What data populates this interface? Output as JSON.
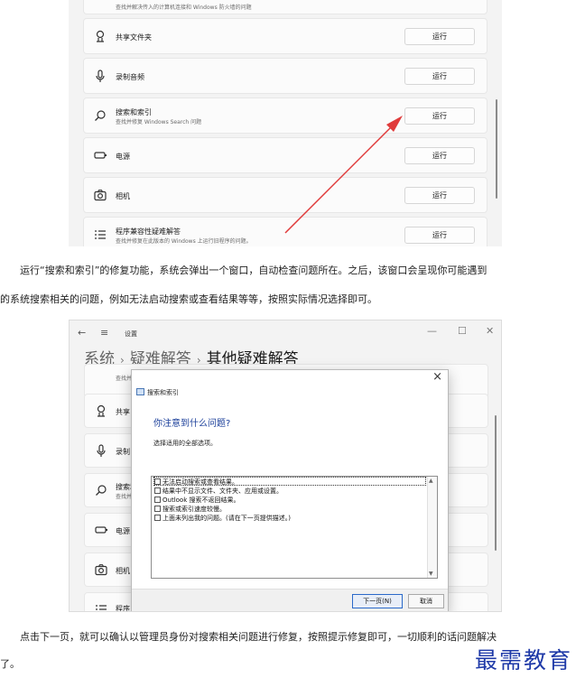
{
  "shot1": {
    "top_partial_subtitle": "查找并解决传入的计算机连接和 Windows 防火墙的问题",
    "rows": [
      {
        "icon": "share-icon",
        "title": "共享文件夹",
        "subtitle": "",
        "button": "运行"
      },
      {
        "icon": "microphone-icon",
        "title": "录制音频",
        "subtitle": "",
        "button": "运行"
      },
      {
        "icon": "search-icon",
        "title": "搜索和索引",
        "subtitle": "查找并修复 Windows Search 问题",
        "button": "运行"
      },
      {
        "icon": "battery-icon",
        "title": "电源",
        "subtitle": "",
        "button": "运行"
      },
      {
        "icon": "camera-icon",
        "title": "相机",
        "subtitle": "",
        "button": "运行"
      },
      {
        "icon": "list-icon",
        "title": "程序兼容性疑难解答",
        "subtitle": "查找并修复在此版本的 Windows 上运行旧程序的问题。",
        "button": "运行"
      }
    ]
  },
  "para1": {
    "line1": "运行“搜索和索引”的修复功能，系统会弹出一个窗口，自动检查问题所在。之后，该窗口会呈现你可能遇到",
    "line2": "的系统搜索相关的问题，例如无法启动搜索或查看结果等等，按照实际情况选择即可。"
  },
  "shot2": {
    "back": "←",
    "menu": "≡",
    "app_title": "设置",
    "minimize": "—",
    "maximize": "☐",
    "close": "✕",
    "breadcrumb": [
      "系统",
      "疑难解答",
      "其他疑难解答"
    ],
    "separator": "›",
    "rows": [
      {
        "title": "",
        "subtitle": "查找并"
      },
      {
        "title": "共享",
        "subtitle": ""
      },
      {
        "title": "录制",
        "subtitle": ""
      },
      {
        "title": "搜索和",
        "subtitle": "查找并"
      },
      {
        "title": "电源",
        "subtitle": ""
      },
      {
        "title": "相机",
        "subtitle": ""
      },
      {
        "title": "程序",
        "subtitle": ""
      }
    ],
    "dialog": {
      "close": "×",
      "header": "搜索和索引",
      "question": "你注意到什么问题?",
      "hint": "选择适用的全部选项。",
      "options": [
        "无法启动搜索或查看结果。",
        "结果中不显示文件、文件夹、应用或设置。",
        "Outlook 搜索不返回结果。",
        "搜索或索引速度较慢。",
        "上面未列出我的问题。(请在下一页提供描述。)"
      ],
      "next_button": "下一页(N)",
      "cancel_button": "取消"
    }
  },
  "para2": {
    "line1": "点击下一页，就可以确认以管理员身份对搜索相关问题进行修复，按照提示修复即可，一切顺利的话问题解决",
    "line2": "了。"
  },
  "logo": "最需教育",
  "colors": {
    "arrow": "#e03b3b",
    "dialog_question": "#1b3f9a",
    "logo": "#1f3aa8"
  }
}
